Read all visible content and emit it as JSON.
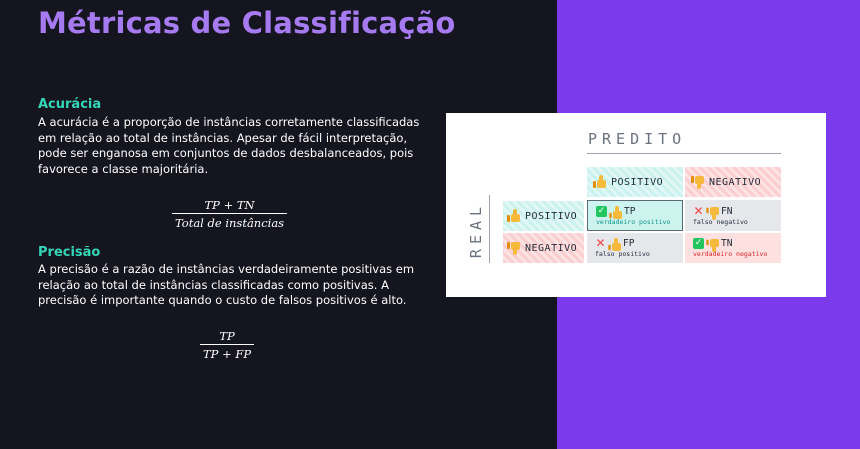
{
  "title": "Métricas de Classificação",
  "accuracy": {
    "heading": "Acurácia",
    "lines": [
      "A acurácia é a proporção de instâncias corretamente classificadas",
      "em relação ao total de instâncias. Apesar de fácil interpretação,",
      "pode ser enganosa em conjuntos de dados desbalanceados, pois",
      "favorece a classe majoritária."
    ],
    "formula_numerator": "TP + TN",
    "formula_denominator": "Total de instâncias"
  },
  "precision": {
    "heading": "Precisão",
    "lines": [
      "A precisão é a razão de instâncias verdadeiramente positivas em",
      "relação ao total de instâncias classificadas como positivas. A",
      "precisão é importante quando o custo de falsos positivos é alto."
    ],
    "formula_numerator": "TP",
    "formula_denominator": "TP + FP"
  },
  "matrix": {
    "predicted_label": "PREDITO",
    "real_label": "REAL",
    "col_positive": "POSITIVO",
    "col_negative": "NEGATIVO",
    "row_positive": "POSITIVO",
    "row_negative": "NEGATIVO",
    "tp": {
      "abbr": "TP",
      "desc": "verdadeiro positivo"
    },
    "fn": {
      "abbr": "FN",
      "desc": "falso negativo"
    },
    "fp": {
      "abbr": "FP",
      "desc": "falso positivo"
    },
    "tn": {
      "abbr": "TN",
      "desc": "verdadeiro negativo"
    }
  },
  "colors": {
    "background": "#15151f",
    "accent_panel": "#7c3aed",
    "title": "#a67af0",
    "heading": "#34d6b8"
  },
  "icons": [
    "thumbs-up-icon",
    "thumbs-down-icon",
    "check-icon",
    "cross-icon"
  ]
}
